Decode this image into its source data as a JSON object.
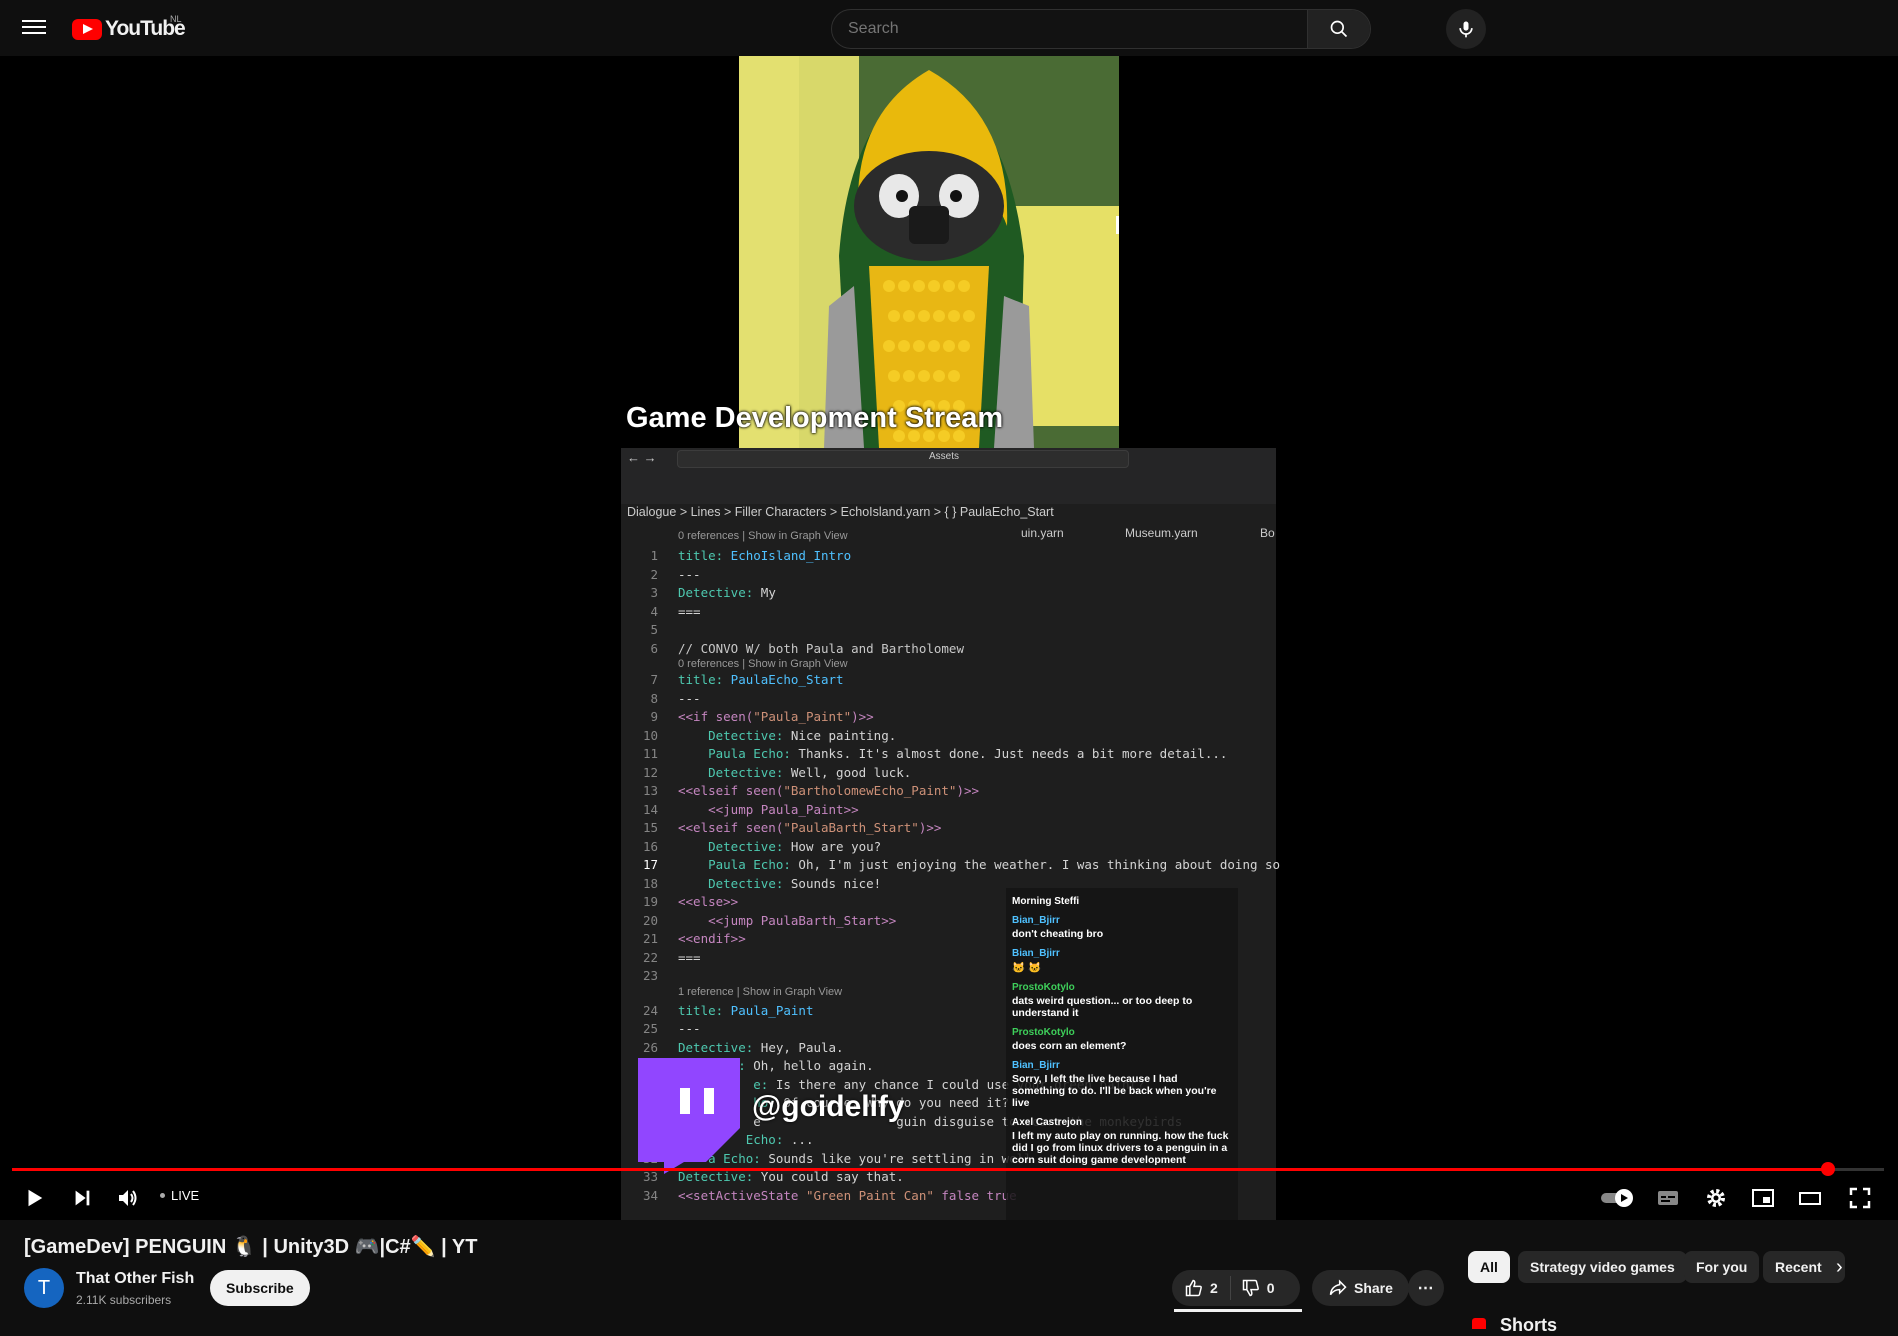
{
  "header": {
    "logo_text": "YouTube",
    "country_code": "NL",
    "search_placeholder": "Search"
  },
  "player": {
    "stream_title": "Game Development Stream",
    "editor_tabs": [
      "uin.yarn",
      "Museum.yarn",
      "Bo"
    ],
    "assets_label": "Assets",
    "breadcrumb": [
      "Dialogue",
      "Lines",
      "Filler Characters",
      "EchoIsland.yarn",
      "PaulaEcho_Start"
    ],
    "refs": [
      "0 references | Show in Graph View",
      "0 references | Show in Graph View",
      "1 reference | Show in Graph View"
    ],
    "code": [
      {
        "n": "1",
        "t": "title: EchoIsland_Intro"
      },
      {
        "n": "2",
        "t": "---"
      },
      {
        "n": "3",
        "t": "Detective: My"
      },
      {
        "n": "4",
        "t": "==="
      },
      {
        "n": "5",
        "t": ""
      },
      {
        "n": "6",
        "t": "// CONVO W/ both Paula and Bartholomew"
      },
      {
        "n": "7",
        "t": "title: PaulaEcho_Start"
      },
      {
        "n": "8",
        "t": "---"
      },
      {
        "n": "9",
        "t": "<<if seen(\"Paula_Paint\")>>"
      },
      {
        "n": "10",
        "t": "    Detective: Nice painting."
      },
      {
        "n": "11",
        "t": "    Paula Echo: Thanks. It's almost done. Just needs a bit more detail..."
      },
      {
        "n": "12",
        "t": "    Detective: Well, good luck."
      },
      {
        "n": "13",
        "t": "<<elseif seen(\"BartholomewEcho_Paint\")>>"
      },
      {
        "n": "14",
        "t": "    <<jump Paula_Paint>>"
      },
      {
        "n": "15",
        "t": "<<elseif seen(\"PaulaBarth_Start\")>>"
      },
      {
        "n": "16",
        "t": "    Detective: How are you?"
      },
      {
        "n": "17",
        "t": "    Paula Echo: Oh, I'm just enjoying the weather. I was thinking about doing so"
      },
      {
        "n": "18",
        "t": "    Detective: Sounds nice!"
      },
      {
        "n": "19",
        "t": "<<else>>"
      },
      {
        "n": "20",
        "t": "    <<jump PaulaBarth_Start>>"
      },
      {
        "n": "21",
        "t": "<<endif>>"
      },
      {
        "n": "22",
        "t": "==="
      },
      {
        "n": "23",
        "t": ""
      },
      {
        "n": "24",
        "t": "title: Paula_Paint"
      },
      {
        "n": "25",
        "t": "---"
      },
      {
        "n": "26",
        "t": "Detective: Hey, Paula."
      },
      {
        "n": "27",
        "t": "    Echo: Oh, hello again."
      },
      {
        "n": "28",
        "t": "          e: Is there any chance I could use your green paint?"
      },
      {
        "n": "29",
        "t": "          ho: Of course. Why do you need it?"
      },
      {
        "n": "30",
        "t": "          e                  guin disguise to scare the monkeybirds"
      },
      {
        "n": "31",
        "t": "         Echo: ..."
      },
      {
        "n": "32",
        "t": "    a Echo: Sounds like you're settling in well"
      },
      {
        "n": "33",
        "t": "Detective: You could say that."
      },
      {
        "n": "34",
        "t": "<<setActiveState \"Green Paint Can\" false true"
      }
    ],
    "chat": [
      {
        "user": "Morning Steffi",
        "msg": "",
        "color": "#ffffff"
      },
      {
        "user": "Bian_Bjirr",
        "msg": "don't cheating bro",
        "color": "#4fc1ff"
      },
      {
        "user": "Bian_Bjirr",
        "msg": "🐱 🐱",
        "color": "#4fc1ff"
      },
      {
        "user": "ProstoKotylo",
        "msg": "dats weird question... or too deep to understand it",
        "color": "#3ecf5a"
      },
      {
        "user": "ProstoKotylo",
        "msg": "does corn an element?",
        "color": "#3ecf5a"
      },
      {
        "user": "Bian_Bjirr",
        "msg": "Sorry, I left the live because I had something to do. I'll be back when you're live",
        "color": "#4fc1ff"
      },
      {
        "user": "Axel Castrejon",
        "msg": "I left my auto play on running. how the fuck did I go from linux drivers to a penguin in a corn suit doing game development",
        "color": "#ffffff"
      }
    ],
    "twitch_handle": "@goidelify",
    "live_label": "LIVE",
    "progress": 0.97
  },
  "video": {
    "title": "[GameDev] PENGUIN 🐧 | Unity3D 🎮|C#✏️ | YT",
    "channel_initial": "T",
    "channel_name": "That Other Fish",
    "subscribers": "2.11K subscribers",
    "subscribe_label": "Subscribe",
    "likes": "2",
    "dislikes": "0",
    "share_label": "Share"
  },
  "chips": [
    "All",
    "Strategy video games",
    "For you",
    "Recent"
  ],
  "shorts_label": "Shorts"
}
